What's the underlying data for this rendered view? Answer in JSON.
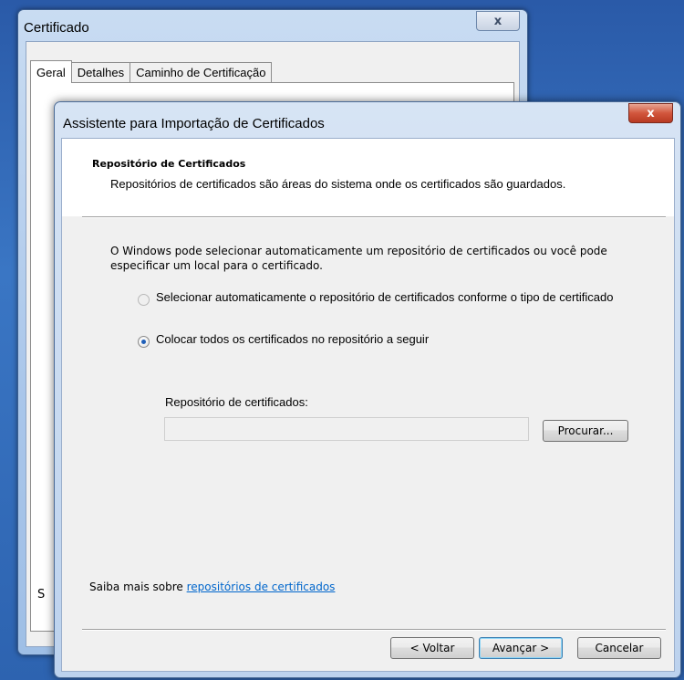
{
  "background_window": {
    "title": "Certificado",
    "close_glyph": "x",
    "tabs": [
      {
        "label": "Geral",
        "active": true
      },
      {
        "label": "Detalhes",
        "active": false
      },
      {
        "label": "Caminho de Certificação",
        "active": false
      }
    ],
    "partial_text": "S"
  },
  "wizard": {
    "title": "Assistente para Importação de Certificados",
    "close_glyph": "x",
    "header": {
      "title": "Repositório de Certificados",
      "subtitle": "Repositórios de certificados são áreas do sistema onde os certificados são guardados."
    },
    "description": "O Windows pode selecionar automaticamente um repositório de certificados ou você pode especificar um local para o certificado.",
    "options": [
      {
        "label": "Selecionar automaticamente o repositório de certificados conforme o tipo de certificado",
        "checked": false,
        "enabled": false
      },
      {
        "label": "Colocar todos os certificados no repositório a seguir",
        "checked": true,
        "enabled": true
      }
    ],
    "store_label": "Repositório de certificados:",
    "store_value": "",
    "browse_button": "Procurar...",
    "learn_more_prefix": "Saiba mais sobre ",
    "learn_more_link": "repositórios de certificados",
    "buttons": {
      "back": "< Voltar",
      "next": "Avançar >",
      "cancel": "Cancelar"
    }
  },
  "colors": {
    "desktop": "#2d63b0",
    "link": "#0066cc",
    "close_red": "#c8452d",
    "radio_dot": "#1f5fb8"
  }
}
